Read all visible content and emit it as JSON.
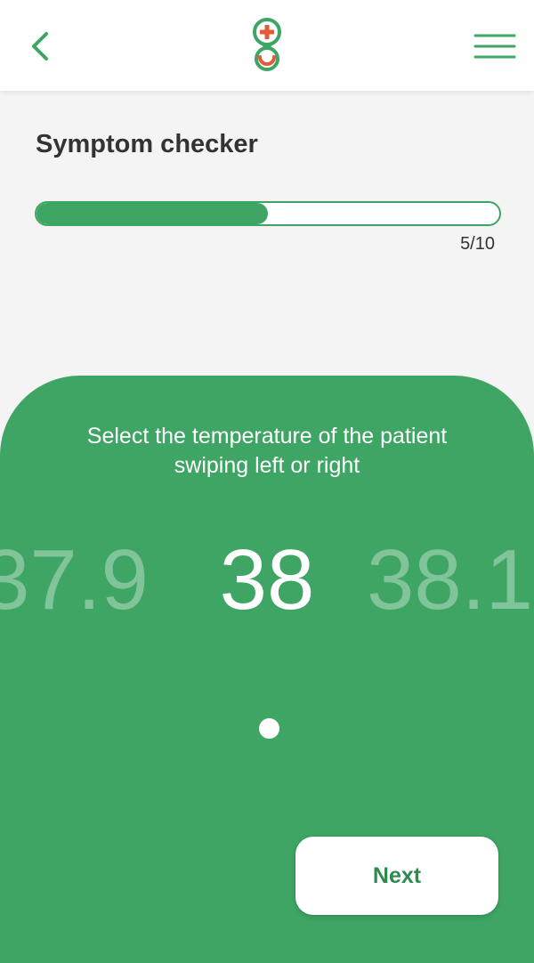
{
  "header": {
    "back_icon": "chevron-left-icon",
    "logo_icon": "medical-pin-logo-icon",
    "menu_icon": "hamburger-menu-icon"
  },
  "page": {
    "title": "Symptom checker"
  },
  "progress": {
    "current": 5,
    "total": 10,
    "label": "5/10"
  },
  "picker": {
    "instruction": "Select the temperature of the patient\nswiping left or right",
    "previous_value": "37.9",
    "current_value": "38",
    "next_value": "38.1"
  },
  "actions": {
    "next_label": "Next"
  },
  "colors": {
    "accent": "#3ea564",
    "logo_red": "#e35a3a",
    "background": "#f4f4f4",
    "text_dark": "#333333",
    "white": "#ffffff"
  }
}
